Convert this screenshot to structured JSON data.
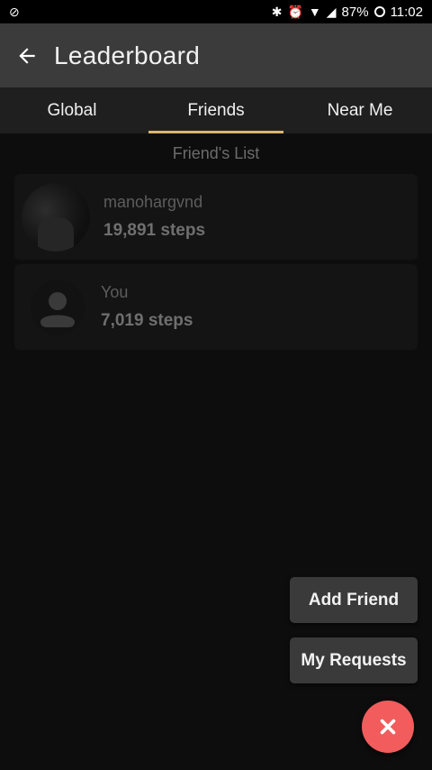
{
  "status_bar": {
    "battery": "87%",
    "time": "11:02"
  },
  "app_bar": {
    "title": "Leaderboard"
  },
  "tabs": [
    {
      "label": "Global"
    },
    {
      "label": "Friends",
      "active": true
    },
    {
      "label": "Near Me"
    }
  ],
  "list_caption": "Friend's List",
  "friends": [
    {
      "name": "manohargvnd",
      "steps": "19,891 steps",
      "avatar": "photo"
    },
    {
      "name": "You",
      "steps": "7,019 steps",
      "avatar": "person-placeholder-icon"
    }
  ],
  "actions": {
    "add_friend": "Add Friend",
    "my_requests": "My Requests"
  },
  "colors": {
    "tab_indicator": "#d8b56e",
    "fab": "#f25c5c"
  }
}
